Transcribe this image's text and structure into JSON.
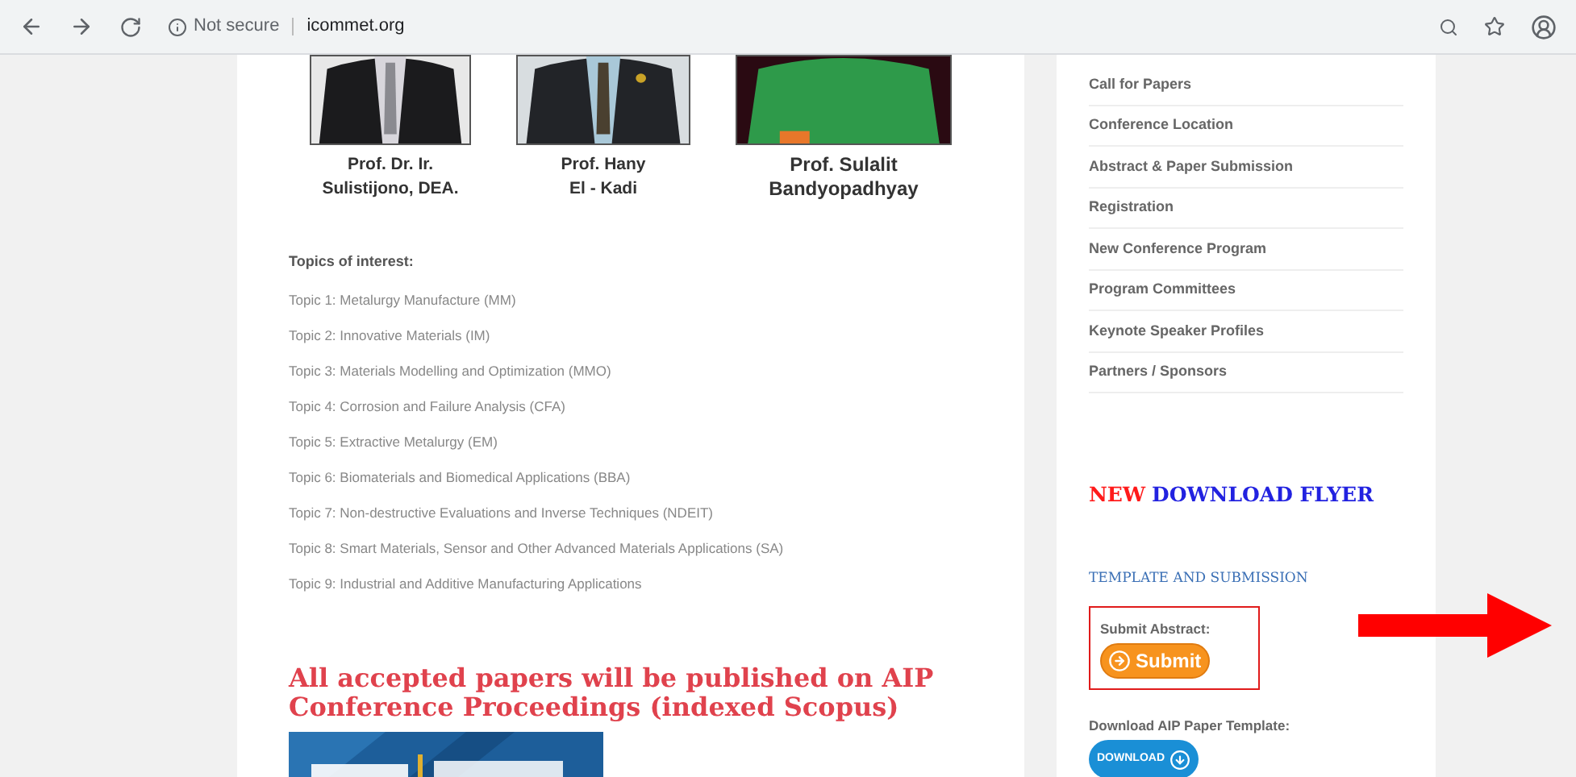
{
  "browser": {
    "security": "Not secure",
    "url": "icommet.org"
  },
  "speakers": [
    {
      "name": "Prof. Dr. Ir.\nSulistijono, DEA."
    },
    {
      "name": "Prof. Hany\nEl - Kadi"
    },
    {
      "name": "Prof. Sulalit\nBandyopadhyay"
    }
  ],
  "topics_heading": "Topics of interest:",
  "topics": [
    "Topic 1: Metalurgy Manufacture (MM)",
    "Topic 2: Innovative Materials (IM)",
    "Topic 3: Materials Modelling and Optimization (MMO)",
    "Topic 4: Corrosion and Failure Analysis (CFA)",
    "Topic 5: Extractive Metalurgy (EM)",
    "Topic 6: Biomaterials and Biomedical Applications (BBA)",
    "Topic 7: Non-destructive Evaluations and Inverse Techniques (NDEIT)",
    "Topic 8: Smart Materials, Sensor and Other Advanced Materials Applications (SA)",
    "Topic 9: Industrial and Additive Manufacturing Applications"
  ],
  "publication_notice": "All accepted papers will be published on AIP Conference Proceedings (indexed Scopus)",
  "sidebar": {
    "menu": [
      "Call for Papers",
      "Conference Location",
      "Abstract & Paper Submission",
      "Registration",
      "New Conference Program",
      "Program Committees",
      "Keynote Speaker Profiles",
      "Partners / Sponsors"
    ],
    "flyer": {
      "new": "NEW",
      "link": "DOWNLOAD FLYER"
    },
    "section_title": "TEMPLATE AND SUBMISSION",
    "submit_label": "Submit Abstract:",
    "submit_button": "Submit",
    "submit_highlighted": true,
    "template_label": "Download AIP Paper Template:",
    "download_button": "DOWNLOAD"
  }
}
